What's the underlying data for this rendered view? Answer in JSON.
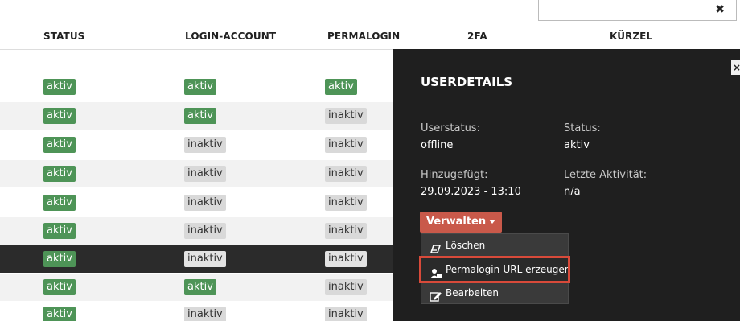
{
  "search": {
    "clear_icon": "✖"
  },
  "table": {
    "headers": {
      "status": "STATUS",
      "login_account": "LOGIN-ACCOUNT",
      "permalogin": "PERMALOGIN",
      "twofa": "2FA",
      "kuerzel": "KÜRZEL"
    },
    "rows": [
      {
        "status": "aktiv",
        "login": "aktiv",
        "permalogin": "aktiv"
      },
      {
        "status": "aktiv",
        "login": "aktiv",
        "permalogin": "inaktiv"
      },
      {
        "status": "aktiv",
        "login": "inaktiv",
        "permalogin": "inaktiv"
      },
      {
        "status": "aktiv",
        "login": "inaktiv",
        "permalogin": "inaktiv"
      },
      {
        "status": "aktiv",
        "login": "inaktiv",
        "permalogin": "inaktiv"
      },
      {
        "status": "aktiv",
        "login": "inaktiv",
        "permalogin": "inaktiv"
      },
      {
        "status": "aktiv",
        "login": "inaktiv",
        "permalogin": "inaktiv"
      },
      {
        "status": "aktiv",
        "login": "aktiv",
        "permalogin": "inaktiv"
      },
      {
        "status": "aktiv",
        "login": "inaktiv",
        "permalogin": "inaktiv"
      }
    ]
  },
  "panel": {
    "title": "USERDETAILS",
    "close_icon": "×",
    "userstatus_label": "Userstatus:",
    "userstatus_value": "offline",
    "status_label": "Status:",
    "status_value": "aktiv",
    "added_label": "Hinzugefügt:",
    "added_value": "29.09.2023 - 13:10",
    "last_activity_label": "Letzte Aktivität:",
    "last_activity_value": "n/a",
    "manage_button": "Verwalten",
    "menu": {
      "delete": "Löschen",
      "permalogin": "Permalogin-URL erzeugen",
      "edit": "Bearbeiten"
    }
  },
  "colors": {
    "active_badge": "#4e9457",
    "inactive_badge": "#d9d9d9",
    "panel_bg": "#1f1f1f",
    "accent": "#c9594a",
    "highlight": "#d84a3a"
  }
}
